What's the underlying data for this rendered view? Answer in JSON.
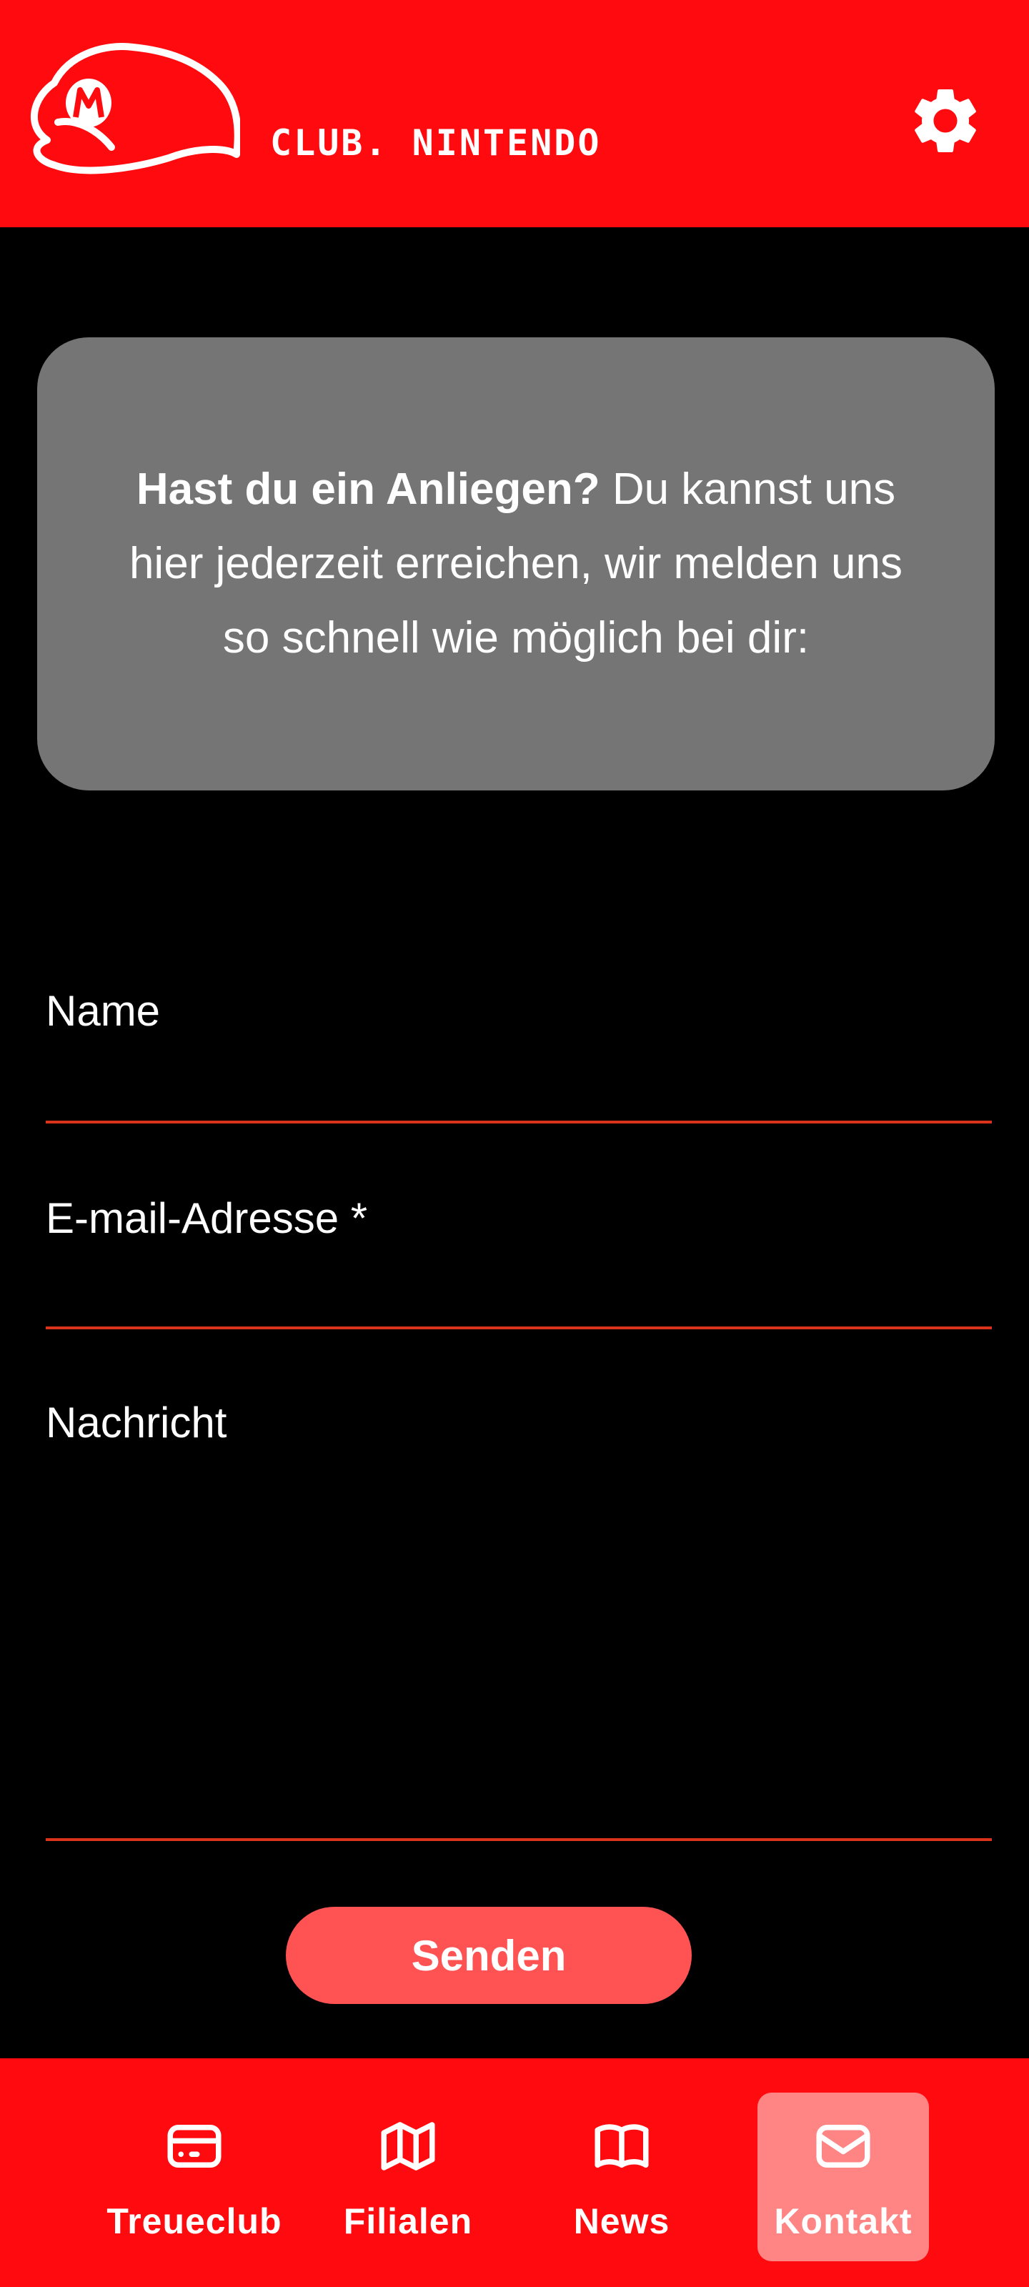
{
  "header": {
    "brand": "CLUB. NINTENDO",
    "settings_icon": "gear-icon",
    "logo_icon": "mario-cap-logo-icon",
    "background_color": "#ff0a0f"
  },
  "info": {
    "bold_text": "Hast du ein Anliegen?",
    "text": " Du kannst uns hier jederzeit erreichen, wir melden uns so schnell wie möglich bei dir:"
  },
  "form": {
    "name_label": "Name",
    "name_value": "",
    "email_label": "E-mail-Adresse *",
    "email_value": "",
    "message_label": "Nachricht",
    "message_value": "",
    "submit_label": "Senden",
    "underline_color": "#d9331c",
    "submit_color": "#ff5252"
  },
  "nav": {
    "items": [
      {
        "label": "Treueclub",
        "icon": "card-icon",
        "active": false
      },
      {
        "label": "Filialen",
        "icon": "map-icon",
        "active": false
      },
      {
        "label": "News",
        "icon": "book-icon",
        "active": false
      },
      {
        "label": "Kontakt",
        "icon": "mail-icon",
        "active": true
      }
    ],
    "active_color": "#ff8585"
  }
}
